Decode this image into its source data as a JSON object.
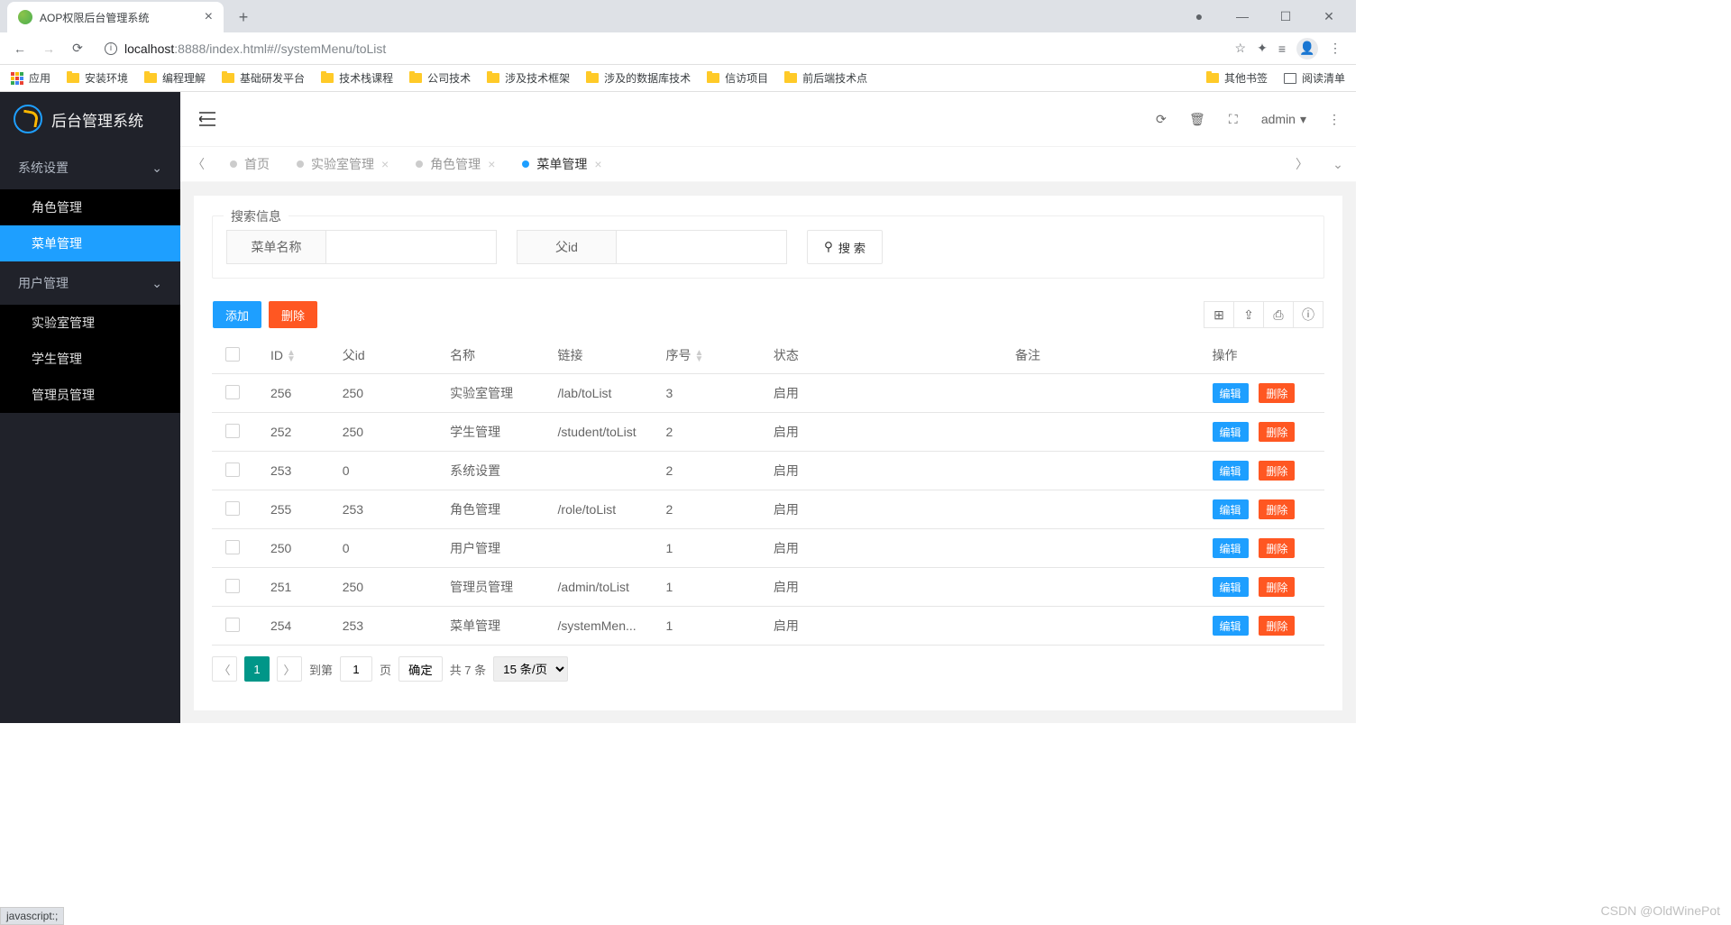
{
  "browser": {
    "tab_title": "AOP权限后台管理系统",
    "url_host": "localhost",
    "url_port": ":8888",
    "url_path": "/index.html#//systemMenu/toList",
    "apps_label": "应用",
    "bookmarks": [
      "安装环境",
      "编程理解",
      "基础研发平台",
      "技术栈课程",
      "公司技术",
      "涉及技术框架",
      "涉及的数据库技术",
      "信访项目",
      "前后端技术点"
    ],
    "other_bookmarks": "其他书签",
    "reading_list": "阅读清单",
    "status_text": "javascript:;"
  },
  "app": {
    "logo_text": "后台管理系统",
    "menu": {
      "group1": "系统设置",
      "role": "角色管理",
      "menu_mgmt": "菜单管理",
      "group2": "用户管理",
      "lab": "实验室管理",
      "student": "学生管理",
      "admin": "管理员管理"
    },
    "header": {
      "username": "admin"
    },
    "tabs": {
      "home": "首页",
      "lab": "实验室管理",
      "role": "角色管理",
      "menu": "菜单管理"
    },
    "search": {
      "legend": "搜索信息",
      "name_label": "菜单名称",
      "pid_label": "父id",
      "btn": "搜 索"
    },
    "toolbar": {
      "add": "添加",
      "delete": "删除"
    },
    "columns": {
      "id": "ID",
      "pid": "父id",
      "name": "名称",
      "link": "链接",
      "seq": "序号",
      "status": "状态",
      "remark": "备注",
      "ops": "操作"
    },
    "row_ops": {
      "edit": "编辑",
      "delete": "删除"
    },
    "rows": [
      {
        "id": "256",
        "pid": "250",
        "name": "实验室管理",
        "link": "/lab/toList",
        "seq": "3",
        "status": "启用"
      },
      {
        "id": "252",
        "pid": "250",
        "name": "学生管理",
        "link": "/student/toList",
        "seq": "2",
        "status": "启用"
      },
      {
        "id": "253",
        "pid": "0",
        "name": "系统设置",
        "link": "",
        "seq": "2",
        "status": "启用"
      },
      {
        "id": "255",
        "pid": "253",
        "name": "角色管理",
        "link": "/role/toList",
        "seq": "2",
        "status": "启用"
      },
      {
        "id": "250",
        "pid": "0",
        "name": "用户管理",
        "link": "",
        "seq": "1",
        "status": "启用"
      },
      {
        "id": "251",
        "pid": "250",
        "name": "管理员管理",
        "link": "/admin/toList",
        "seq": "1",
        "status": "启用"
      },
      {
        "id": "254",
        "pid": "253",
        "name": "菜单管理",
        "link": "/systemMen...",
        "seq": "1",
        "status": "启用"
      }
    ],
    "pagination": {
      "current": "1",
      "goto_label": "到第",
      "page_label": "页",
      "confirm": "确定",
      "total": "共 7 条",
      "per_page": "15 条/页"
    }
  },
  "watermark": "CSDN @OldWinePot"
}
